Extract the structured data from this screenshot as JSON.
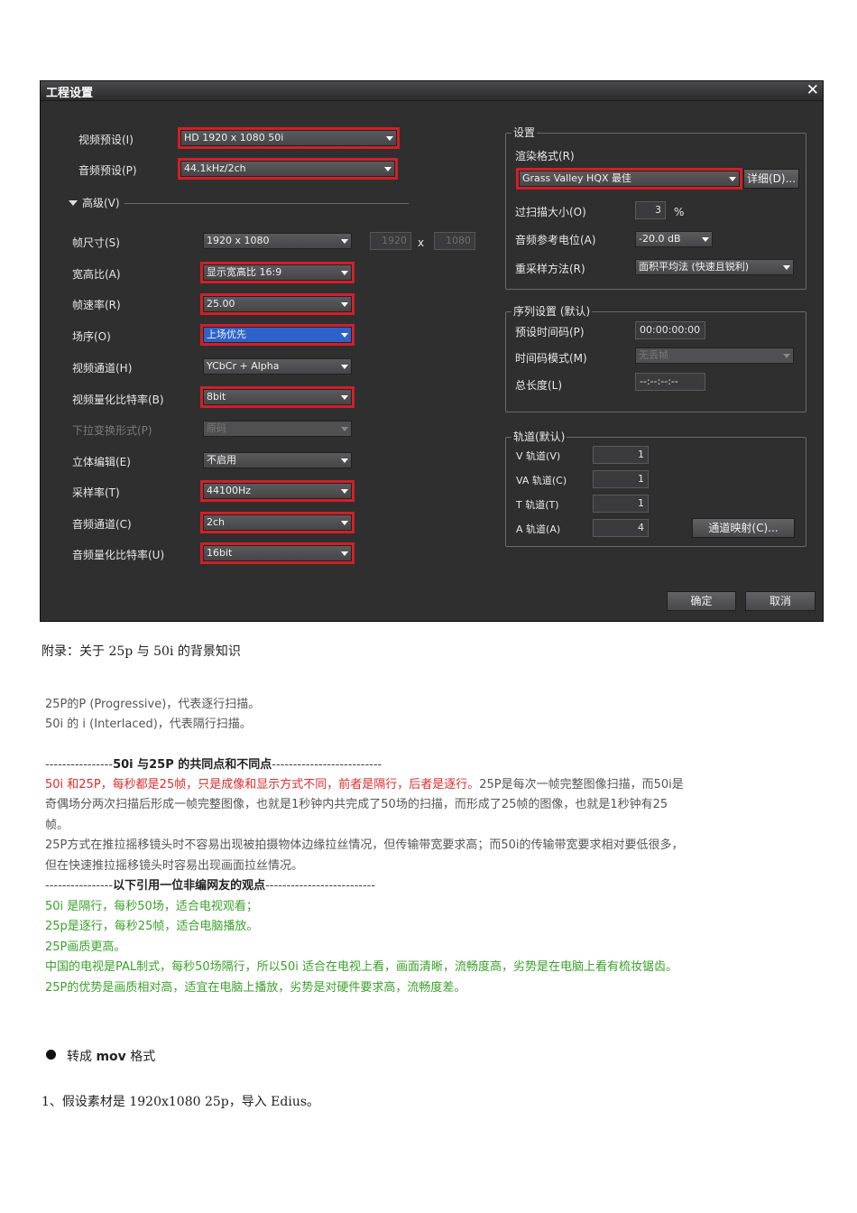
{
  "dialog": {
    "title": "工程设置",
    "close_glyph": "✕",
    "video_preset_label": "视频预设(I)",
    "video_preset_value": "HD 1920 x 1080 50i",
    "audio_preset_label": "音频预设(P)",
    "audio_preset_value": "44.1kHz/2ch",
    "advanced_label": "高级(V)",
    "frame_size_label": "帧尺寸(S)",
    "frame_size_value": "1920 x 1080",
    "frame_width": "1920",
    "frame_x": "x",
    "frame_height": "1080",
    "aspect_label": "宽高比(A)",
    "aspect_value": "显示宽高比 16:9",
    "frame_rate_label": "帧速率(R)",
    "frame_rate_value": "25.00",
    "field_order_label": "场序(O)",
    "field_order_value": "上场优先",
    "video_channel_label": "视频通道(H)",
    "video_channel_value": "YCbCr + Alpha",
    "video_bitdepth_label": "视频量化比特率(B)",
    "video_bitdepth_value": "8bit",
    "pulldown_label": "下拉变换形式(P)",
    "pulldown_value": "原码",
    "stereo_label": "立体编辑(E)",
    "stereo_value": "不启用",
    "sample_rate_label": "采样率(T)",
    "sample_rate_value": "44100Hz",
    "audio_channel_label": "音频通道(C)",
    "audio_channel_value": "2ch",
    "audio_bitdepth_label": "音频量化比特率(U)",
    "audio_bitdepth_value": "16bit",
    "settings_group": "设置",
    "render_format_label": "渲染格式(R)",
    "render_format_value": "Grass Valley HQX 最佳",
    "detail_button": "详细(D)...",
    "overscan_label": "过扫描大小(O)",
    "overscan_value": "3",
    "overscan_unit": "%",
    "audio_ref_label": "音频参考电位(A)",
    "audio_ref_value": "-20.0 dB",
    "resample_label": "重采样方法(R)",
    "resample_value": "面积平均法 (快速且锐利)",
    "sequence_group": "序列设置 (默认)",
    "preset_tc_label": "预设时间码(P)",
    "preset_tc_value": "00:00:00:00",
    "tc_mode_label": "时间码模式(M)",
    "tc_mode_value": "无丢帧",
    "total_length_label": "总长度(L)",
    "total_length_value": "--:--:--:--",
    "tracks_group": "轨道(默认)",
    "v_track_label": "V 轨道(V)",
    "v_track_value": "1",
    "va_track_label": "VA 轨道(C)",
    "va_track_value": "1",
    "t_track_label": "T 轨道(T)",
    "t_track_value": "1",
    "a_track_label": "A 轨道(A)",
    "a_track_value": "4",
    "channel_map_button": "通道映射(C)...",
    "ok_button": "确定",
    "cancel_button": "取消"
  },
  "doc": {
    "appendix": "附录：关于 25p 与 50i 的背景知识",
    "note1": "25P的P (Progressive)，代表逐行扫描。",
    "note2": "50i 的 i (Interlaced)，代表隔行扫描。",
    "sec1_prefix": "----------------",
    "sec1_title": "50i 与25P 的共同点和不同点",
    "sec1_suffix": "--------------------------",
    "red_line": "50i 和25P，每秒都是25帧，只是成像和显示方式不同，前者是隔行，后者是逐行。",
    "gray_line1_tail": "25P是每次一帧完整图像扫描，而50i是",
    "gray_line2": "奇偶场分两次扫描后形成一帧完整图像，也就是1秒钟内共完成了50场的扫描，而形成了25帧的图像，也就是1秒钟有25",
    "gray_line3": "帧。",
    "gray_line4": "25P方式在推拉摇移镜头时不容易出现被拍摄物体边缘拉丝情况，但传输带宽要求高；而50i的传输带宽要求相对要低很多，",
    "gray_line5": "但在快速推拉摇移镜头时容易出现画面拉丝情况。",
    "sec2_prefix": "----------------",
    "sec2_title": "以下引用一位非编网友的观点",
    "sec2_suffix": "--------------------------",
    "green1": "50i 是隔行，每秒50场，适合电视观看；",
    "green2": "25p是逐行，每秒25帧，适合电脑播放。",
    "green3": "25P画质更高。",
    "green4": "中国的电视是PAL制式，每秒50场隔行，所以50i 适合在电视上看，画面清晰，流畅度高，劣势是在电脑上看有梳妆锯齿。",
    "green5": "25P的优势是画质相对高，适宜在电脑上播放，劣势是对硬件要求高，流畅度差。",
    "bullet_prefix": "转成 ",
    "bullet_bold": "mov",
    "bullet_suffix": " 格式",
    "step1": "1、假设素材是 1920x1080 25p，导入 Edius。"
  }
}
